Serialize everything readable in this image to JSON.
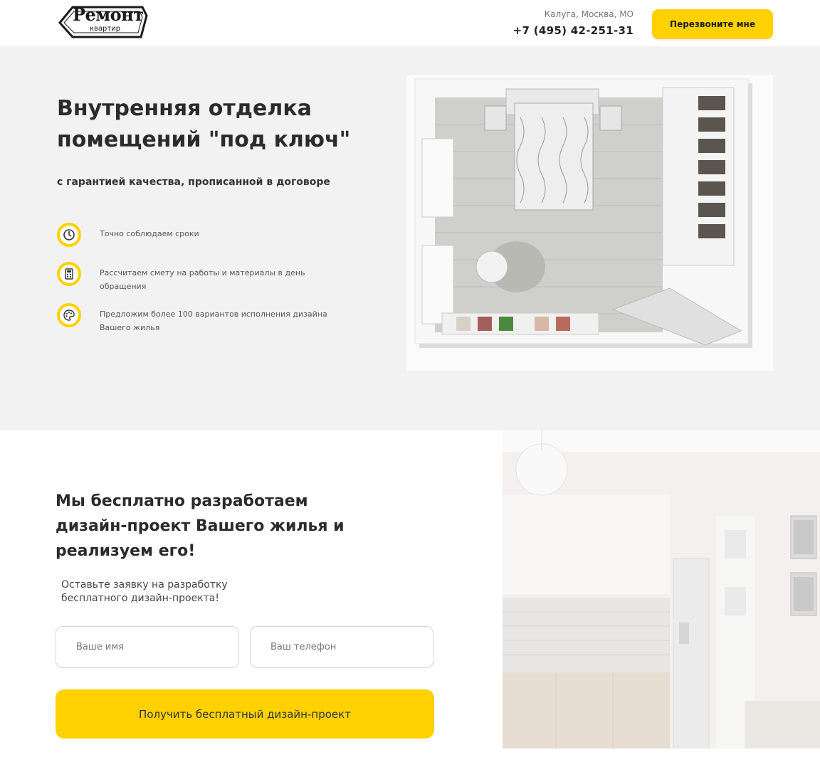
{
  "header": {
    "logo": {
      "big_text": "Ремонт",
      "small_text": "квартир"
    },
    "location": "Калуга, Москва, МО",
    "phone": "+7 (495) 42-251-31",
    "callback_label": "Перезвоните мне"
  },
  "hero": {
    "title": "Внутренняя отделка помещений \"под ключ\"",
    "subtitle": "с гарантией качества, прописанной в договоре",
    "features": [
      {
        "icon": "clock-icon",
        "text": "Точно соблюдаем сроки"
      },
      {
        "icon": "calculator-icon",
        "text": "Рассчитаем смету на работы и материалы в день обращения"
      },
      {
        "icon": "palette-icon",
        "text": "Предложим более 100 вариантов исполнения дизайна Вашего жилья"
      }
    ],
    "image": "bedroom-top-view-image"
  },
  "design_form": {
    "title": "Мы бесплатно разработаем дизайн-проект Вашего жилья и реализуем его!",
    "subtitle": "Оставьте заявку на разработку бесплатного дизайн-проекта!",
    "name_placeholder": "Ваше имя",
    "phone_placeholder": "Ваш телефон",
    "submit_label": "Получить бесплатный дизайн-проект",
    "image": "kitchen-interior-image"
  },
  "colors": {
    "accent": "#ffd100",
    "hero_bg": "#f2f2f2",
    "text_dark": "#2b2b2b"
  }
}
